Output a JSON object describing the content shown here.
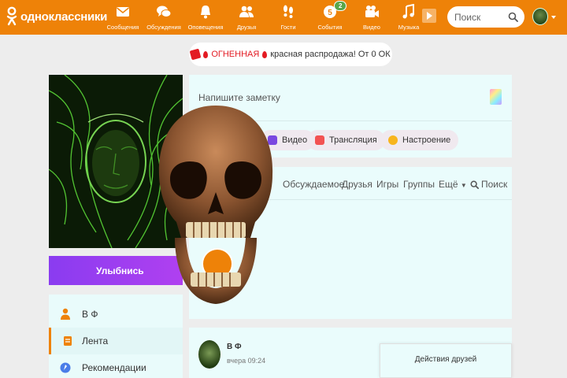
{
  "brand": {
    "name": "одноклассники"
  },
  "nav": [
    {
      "label": "Сообщения",
      "icon": "envelope-icon"
    },
    {
      "label": "Обсуждения",
      "icon": "chat-icon"
    },
    {
      "label": "Оповещения",
      "icon": "bell-icon"
    },
    {
      "label": "Друзья",
      "icon": "friends-icon"
    },
    {
      "label": "Гости",
      "icon": "footprints-icon"
    },
    {
      "label": "События",
      "icon": "events-icon",
      "badge": "2"
    },
    {
      "label": "Видео",
      "icon": "camera-icon"
    },
    {
      "label": "Музыка",
      "icon": "music-icon"
    }
  ],
  "search": {
    "placeholder": "Поиск"
  },
  "promo": {
    "part1": "ОГНЕННАЯ",
    "part2": "красная распродажа! От 0 ОК"
  },
  "profile": {
    "smile_button": "Улыбнись",
    "menu": [
      {
        "label": "В Ф"
      },
      {
        "label": "Лента"
      },
      {
        "label": "Рекомендации"
      }
    ]
  },
  "note": {
    "placeholder": "Напишите заметку",
    "actions": [
      {
        "label": "Видео"
      },
      {
        "label": "Трансляция"
      },
      {
        "label": "Настроение"
      }
    ]
  },
  "feed_tabs": [
    {
      "label": "Обсуждаемое"
    },
    {
      "label": "Друзья"
    },
    {
      "label": "Игры"
    },
    {
      "label": "Группы"
    },
    {
      "label": "Ещё"
    },
    {
      "label": "Поиск"
    }
  ],
  "post": {
    "author": "В Ф",
    "time": "вчера 09:24"
  },
  "friends_panel": {
    "title": "Действия друзей"
  },
  "colors": {
    "accent": "#ee8208",
    "promo_red": "#e31b23",
    "smile_purple": "#8a3cf0",
    "card_bg": "#eafcfc"
  }
}
